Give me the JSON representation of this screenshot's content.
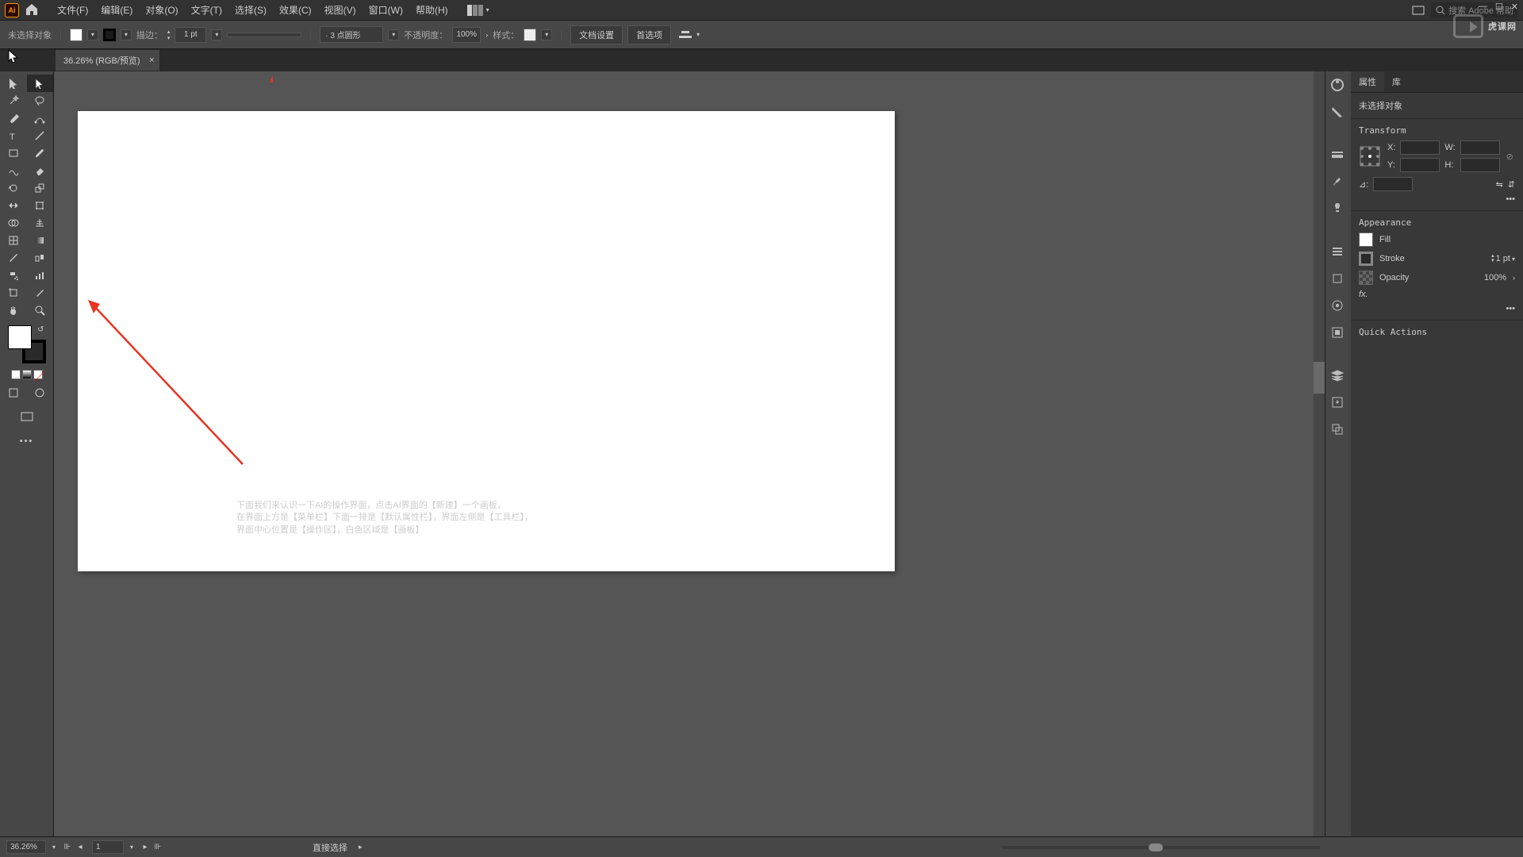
{
  "app": {
    "logo": "Ai",
    "search_placeholder": "搜索 Adobe 帮助"
  },
  "menu": {
    "items": [
      "文件(F)",
      "编辑(E)",
      "对象(O)",
      "文字(T)",
      "选择(S)",
      "效果(C)",
      "视图(V)",
      "窗口(W)",
      "帮助(H)"
    ]
  },
  "controlbar": {
    "no_selection": "未选择对象",
    "stroke_label": "描边：",
    "stroke_val": "1 pt",
    "brush": "· 3 点圆形",
    "opacity_label": "不透明度：",
    "opacity_val": "100%",
    "style_label": "样式：",
    "doc_setup": "文档设置",
    "prefs": "首选项"
  },
  "doc": {
    "tab": "36.26% (RGB/预览)"
  },
  "annot": {
    "line1": "下面我们来认识一下AI的操作界面，点击AI界面的【新建】一个画板，",
    "line2": "在界面上方是【菜单栏】下面一排是【默认属性栏】，界面左侧是【工具栏】，",
    "line3": "界面中心位置是【操作区】，白色区域是【画板】"
  },
  "props": {
    "tab_attr": "属性",
    "tab_lib": "库",
    "no_selection": "未选择对象",
    "transform": "Transform",
    "X": "X:",
    "Y": "Y:",
    "W": "W:",
    "H": "H:",
    "angle": "⊿:",
    "appearance": "Appearance",
    "fill": "Fill",
    "stroke": "Stroke",
    "stroke_val": "1 pt",
    "opacity": "Opacity",
    "opacity_val": "100%",
    "fx": "fx.",
    "quick": "Quick Actions"
  },
  "status": {
    "zoom": "36.26%",
    "artboard": "1",
    "tool": "直接选择"
  },
  "watermark": "虎课网"
}
